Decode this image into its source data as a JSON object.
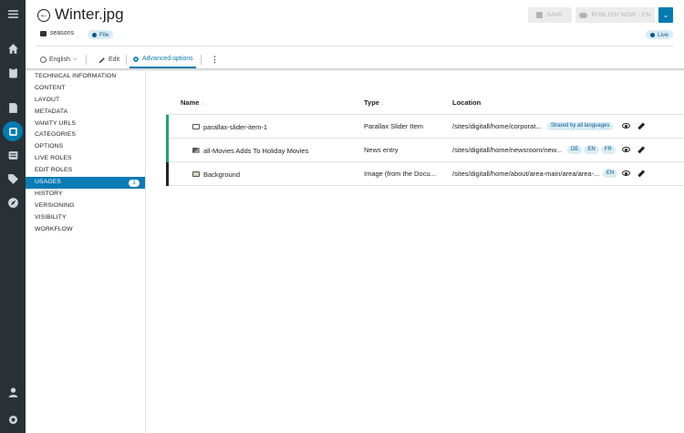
{
  "header": {
    "title": "Winter.jpg",
    "breadcrumb": "seasons",
    "type_chip": "File",
    "status_chip": "Live",
    "save_label": "SAVE",
    "publish_label": "PUBLISH NOW - EN"
  },
  "toolbar": {
    "language": "English",
    "edit_label": "Edit",
    "advanced_label": "Advanced options"
  },
  "sidebar_items": [
    "TECHNICAL INFORMATION",
    "CONTENT",
    "LAYOUT",
    "METADATA",
    "VANITY URLS",
    "CATEGORIES",
    "OPTIONS",
    "LIVE ROLES",
    "EDIT ROLES",
    "USAGES",
    "HISTORY",
    "VERSIONING",
    "VISIBILITY",
    "WORKFLOW"
  ],
  "usages_count": "3",
  "table": {
    "columns": {
      "name": "Name",
      "type": "Type",
      "location": "Location"
    },
    "rows": [
      {
        "name": "parallax-slider-item-1",
        "type": "Parallax Slider Item",
        "location": "/sites/digitall/home/corporat...",
        "langs": [
          "Shared by all languages"
        ],
        "bar_color": "#21a66b"
      },
      {
        "name": "all-Movies Adds To Holiday Movies",
        "type": "News entry",
        "location": "/sites/digitall/home/newsroom/new...",
        "langs": [
          "DE",
          "EN",
          "FR"
        ],
        "bar_color": "#21a66b"
      },
      {
        "name": "Background",
        "type": "Image (from the Docu...",
        "location": "/sites/digitall/home/about/area-main/area/area-...",
        "langs": [
          "EN"
        ],
        "bar_color": "#222222"
      }
    ]
  },
  "colors": {
    "rail": "#293136",
    "accent": "#0a7bb5",
    "published": "#21a66b"
  }
}
